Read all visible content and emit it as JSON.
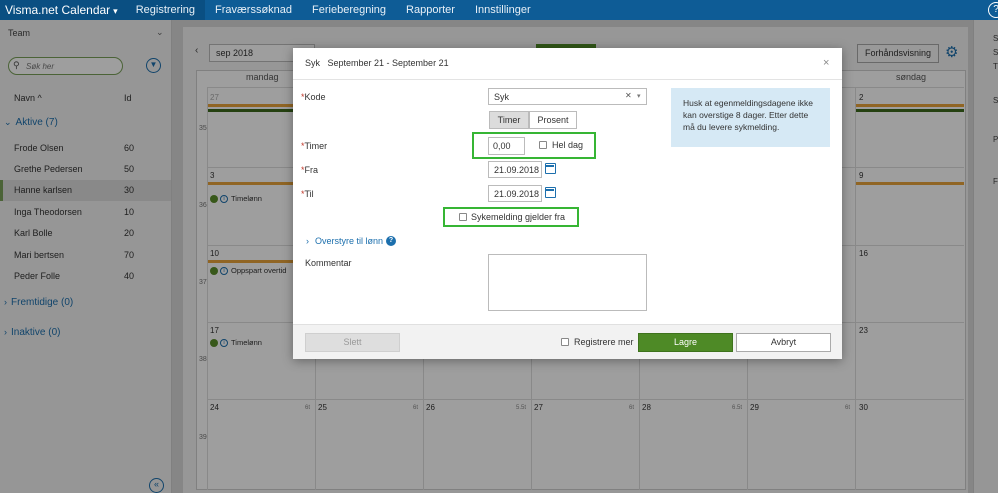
{
  "topnav": {
    "brand": "Visma.net Calendar",
    "items": [
      "Registrering",
      "Fraværssøknad",
      "Ferieberegning",
      "Rapporter",
      "Innstillinger"
    ],
    "help": "?"
  },
  "sidebar": {
    "team_label": "Team",
    "search_placeholder": "Søk her",
    "col_name": "Navn ^",
    "col_id": "Id",
    "groups": {
      "active": "Aktive (7)",
      "future": "Fremtidige (0)",
      "inactive": "Inaktive (0)"
    },
    "employees": [
      {
        "name": "Frode Olsen",
        "id": "60"
      },
      {
        "name": "Grethe Pedersen",
        "id": "50"
      },
      {
        "name": "Hanne karlsen",
        "id": "30"
      },
      {
        "name": "Inga Theodorsen",
        "id": "10"
      },
      {
        "name": "Karl Bolle",
        "id": "20"
      },
      {
        "name": "Mari bertsen",
        "id": "70"
      },
      {
        "name": "Peder Folle",
        "id": "40"
      }
    ]
  },
  "calendar": {
    "month": "sep 2018",
    "preview_label": "Forhåndsvisning",
    "days": [
      "mandag",
      "søndag"
    ],
    "weeks": [
      "35",
      "36",
      "37",
      "38",
      "39"
    ],
    "dates": {
      "w35_mon": "27",
      "w35_sun": "2",
      "w36_mon": "3",
      "w36_sun": "9",
      "w37_mon": "10",
      "w37_sun": "16",
      "w38_mon": "17",
      "w38_sun": "23",
      "w39": [
        "24",
        "25",
        "26",
        "27",
        "28",
        "29",
        "30"
      ]
    },
    "events": {
      "w36": "Timelønn",
      "w37": "Oppspart overtid",
      "w38": "Timelønn"
    },
    "hours": [
      "6t",
      "6t",
      "5.5t",
      "6t",
      "6.5t",
      "6t"
    ]
  },
  "right_panel": {
    "letters": [
      "S",
      "S",
      "T",
      "S",
      "P",
      "F"
    ]
  },
  "colors": {
    "nav": "#0e5c96",
    "accent_green": "#4e8a26",
    "orange": "#e8a43a",
    "dark_green": "#3d6a1c"
  },
  "modal": {
    "title": "Syk   September 21 - September 21",
    "close": "×",
    "labels": {
      "kode": "Kode",
      "timer": "Timer",
      "fra": "Fra",
      "til": "Til",
      "kommentar": "Kommentar"
    },
    "kode_value": "Syk",
    "toggle": {
      "timer": "Timer",
      "prosent": "Prosent"
    },
    "timer_value": "0,00",
    "hel_dag": "Hel dag",
    "fra_value": "21.09.2018",
    "til_value": "21.09.2018",
    "sykemelding": "Sykemelding gjelder fra",
    "overstyre": "Overstyre til lønn",
    "info": "Husk at egenmeldingsdagene ikke kan overstige 8 dager. Etter dette må du levere sykmelding.",
    "footer": {
      "slett": "Slett",
      "registrere_mer": "Registrere mer",
      "lagre": "Lagre",
      "avbryt": "Avbryt"
    }
  }
}
